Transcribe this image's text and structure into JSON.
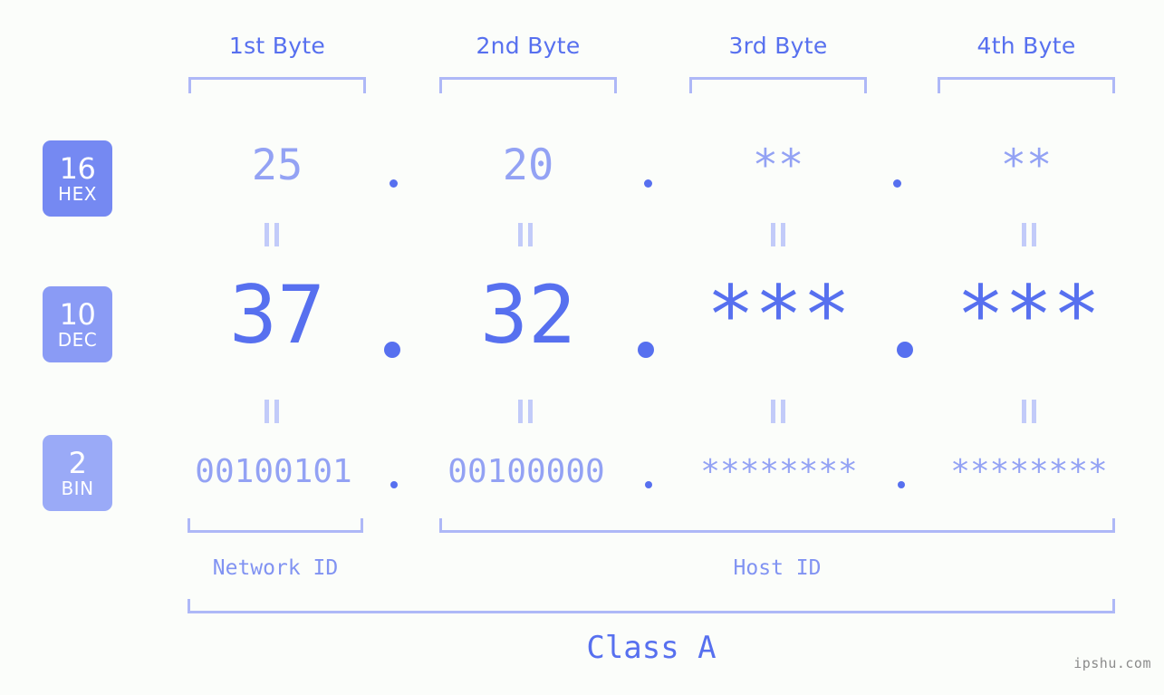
{
  "background_color": "#fbfdfa",
  "accent_color": "#5770ef",
  "muted_color": "#93a2f4",
  "bracket_color": "#aeb8f7",
  "byte_headers": [
    {
      "label": "1st Byte"
    },
    {
      "label": "2nd Byte"
    },
    {
      "label": "3rd Byte"
    },
    {
      "label": "4th Byte"
    }
  ],
  "bases": [
    {
      "num": "16",
      "label": "HEX",
      "color": "#7589f2"
    },
    {
      "num": "10",
      "label": "DEC",
      "color": "#8a9bf5"
    },
    {
      "num": "2",
      "label": "BIN",
      "color": "#9aaaf7"
    }
  ],
  "rows": {
    "hex": {
      "base_num": "16",
      "base_label": "HEX",
      "values": [
        "25",
        "20",
        "**",
        "**"
      ]
    },
    "dec": {
      "base_num": "10",
      "base_label": "DEC",
      "values": [
        "37",
        "32",
        "***",
        "***"
      ]
    },
    "bin": {
      "base_num": "2",
      "base_label": "BIN",
      "values": [
        "00100101",
        "00100000",
        "********",
        "********"
      ]
    }
  },
  "separator": ".",
  "equals_glyph": "||",
  "segments": {
    "network_id": "Network ID",
    "host_id": "Host ID"
  },
  "class_label": "Class A",
  "watermark": "ipshu.com"
}
